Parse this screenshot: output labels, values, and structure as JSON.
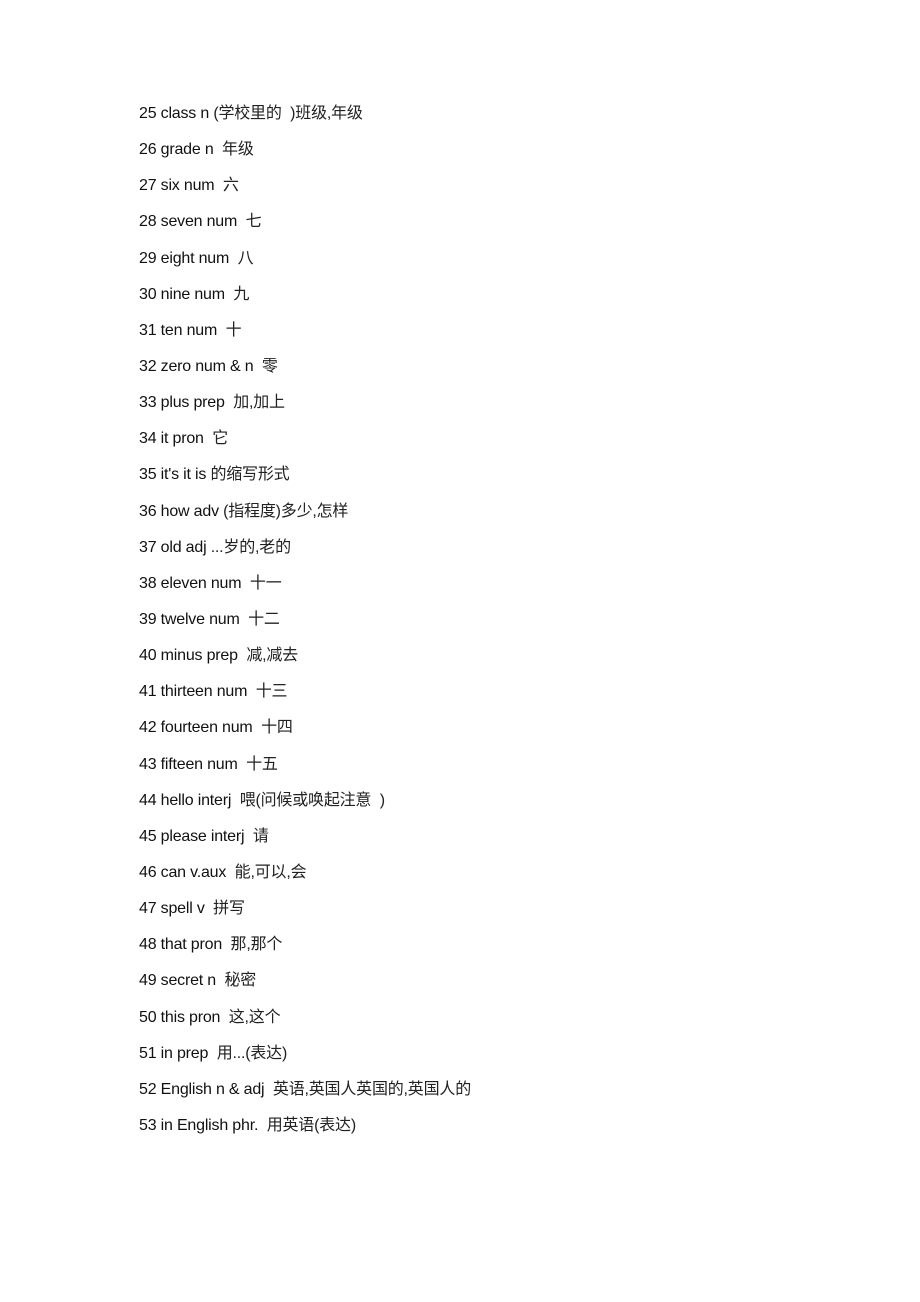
{
  "document": {
    "entries": [
      {
        "num": "25",
        "word": "class",
        "pos": "n",
        "meaning": "(学校里的  )班级,年级",
        "sep": " "
      },
      {
        "num": "26",
        "word": "grade",
        "pos": "n",
        "meaning": "年级",
        "sep": "  "
      },
      {
        "num": "27",
        "word": "six",
        "pos": "num",
        "meaning": "六",
        "sep": "  "
      },
      {
        "num": "28",
        "word": "seven",
        "pos": "num",
        "meaning": "七",
        "sep": "  "
      },
      {
        "num": "29",
        "word": "eight",
        "pos": "num",
        "meaning": "八",
        "sep": "  "
      },
      {
        "num": "30",
        "word": "nine",
        "pos": "num",
        "meaning": "九",
        "sep": "  "
      },
      {
        "num": "31",
        "word": "ten",
        "pos": "num",
        "meaning": "十",
        "sep": "  "
      },
      {
        "num": "32",
        "word": "zero",
        "pos": "num & n",
        "meaning": "零",
        "sep": "  "
      },
      {
        "num": "33",
        "word": "plus",
        "pos": "prep",
        "meaning": "加,加上",
        "sep": "  "
      },
      {
        "num": "34",
        "word": "it",
        "pos": "pron",
        "meaning": "它",
        "sep": "  "
      },
      {
        "num": "35",
        "word": "it's",
        "pos": "it is",
        "meaning": "的缩写形式",
        "sep": " "
      },
      {
        "num": "36",
        "word": "how",
        "pos": "adv",
        "meaning": "(指程度)多少,怎样",
        "sep": " "
      },
      {
        "num": "37",
        "word": "old",
        "pos": "adj",
        "meaning": "...岁的,老的",
        "sep": " "
      },
      {
        "num": "38",
        "word": "eleven",
        "pos": "num",
        "meaning": "十一",
        "sep": "  "
      },
      {
        "num": "39",
        "word": "twelve",
        "pos": "num",
        "meaning": "十二",
        "sep": "  "
      },
      {
        "num": "40",
        "word": "minus",
        "pos": "prep",
        "meaning": "减,减去",
        "sep": "  "
      },
      {
        "num": "41",
        "word": "thirteen",
        "pos": "num",
        "meaning": "十三",
        "sep": "  "
      },
      {
        "num": "42",
        "word": "fourteen",
        "pos": "num",
        "meaning": "十四",
        "sep": "  "
      },
      {
        "num": "43",
        "word": "fifteen",
        "pos": "num",
        "meaning": "十五",
        "sep": "  "
      },
      {
        "num": "44",
        "word": "hello",
        "pos": "interj",
        "meaning": "喂(问候或唤起注意  )",
        "sep": "  "
      },
      {
        "num": "45",
        "word": "please",
        "pos": "interj",
        "meaning": "请",
        "sep": "  "
      },
      {
        "num": "46",
        "word": "can",
        "pos": "v.aux",
        "meaning": "能,可以,会",
        "sep": "  "
      },
      {
        "num": "47",
        "word": "spell",
        "pos": "v",
        "meaning": "拼写",
        "sep": "  "
      },
      {
        "num": "48",
        "word": "that",
        "pos": "pron",
        "meaning": "那,那个",
        "sep": "  "
      },
      {
        "num": "49",
        "word": "secret",
        "pos": "n",
        "meaning": "秘密",
        "sep": "  "
      },
      {
        "num": "50",
        "word": "this",
        "pos": "pron",
        "meaning": "这,这个",
        "sep": "  "
      },
      {
        "num": "51",
        "word": "in",
        "pos": "prep",
        "meaning": "用...(表达)",
        "sep": "  "
      },
      {
        "num": "52",
        "word": "English",
        "pos": "n & adj",
        "meaning": "英语,英国人英国的,英国人的",
        "sep": "  "
      },
      {
        "num": "53",
        "word": "in English",
        "pos": "phr.",
        "meaning": "用英语(表达)",
        "sep": "  "
      }
    ]
  }
}
